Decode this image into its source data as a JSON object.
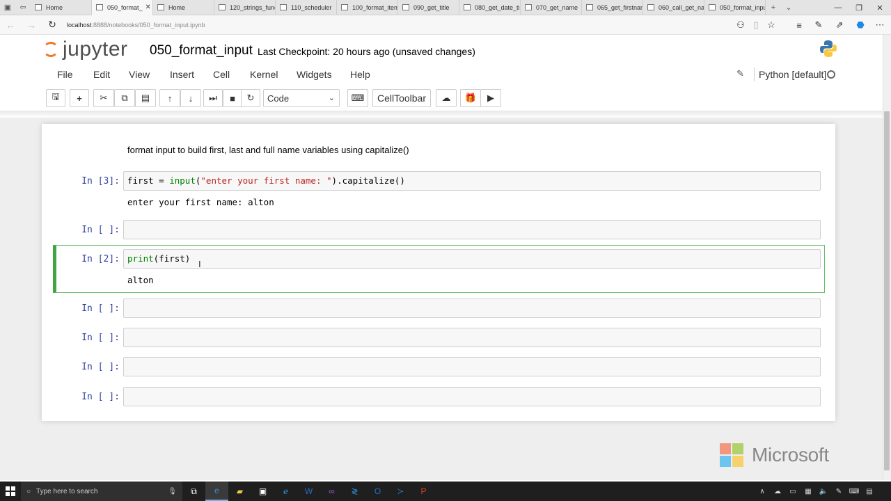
{
  "browser": {
    "tabs": [
      {
        "label": "Home",
        "active": false
      },
      {
        "label": "050_format_",
        "active": true
      },
      {
        "label": "Home",
        "active": false
      },
      {
        "label": "120_strings_func",
        "active": false
      },
      {
        "label": "110_scheduler",
        "active": false
      },
      {
        "label": "100_format_item",
        "active": false
      },
      {
        "label": "090_get_title",
        "active": false
      },
      {
        "label": "080_get_date_tir",
        "active": false
      },
      {
        "label": "070_get_name",
        "active": false
      },
      {
        "label": "065_get_firstnam",
        "active": false
      },
      {
        "label": "060_call_get_nar",
        "active": false
      },
      {
        "label": "050_format_inpu",
        "active": false
      }
    ],
    "url_host": "localhost",
    "url_rest": ":8888/notebooks/050_format_input.ipynb"
  },
  "jupyter": {
    "logo_text": "jupyter",
    "notebook_title": "050_format_input",
    "checkpoint": "Last Checkpoint: 20 hours ago (unsaved changes)",
    "menu": [
      "File",
      "Edit",
      "View",
      "Insert",
      "Cell",
      "Kernel",
      "Widgets",
      "Help"
    ],
    "kernel": "Python [default]",
    "cell_type": "Code",
    "celltoolbar_label": "CellToolbar"
  },
  "notebook": {
    "markdown": "format input to build first, last and full name variables using capitalize()",
    "cells": [
      {
        "prompt": "In [3]:",
        "code": {
          "var": "first",
          "op": " = ",
          "fn": "input",
          "open": "(",
          "str": "\"enter your first name: \"",
          "rest": ").capitalize()"
        },
        "output": "enter your first name: alton"
      },
      {
        "prompt": "In [ ]:"
      },
      {
        "prompt": "In [2]:",
        "code": {
          "fn": "print",
          "rest": "(first)"
        },
        "output": "alton"
      },
      {
        "prompt": "In [ ]:"
      },
      {
        "prompt": "In [ ]:"
      },
      {
        "prompt": "In [ ]:"
      },
      {
        "prompt": "In [ ]:"
      }
    ]
  },
  "watermark": "Microsoft",
  "taskbar": {
    "search_placeholder": "Type here to search"
  },
  "colors": {
    "accent": "#f37726",
    "prompt": "#303f9f",
    "keyword": "#008000",
    "string": "#ba2121",
    "selected_border": "#66bb6a"
  }
}
